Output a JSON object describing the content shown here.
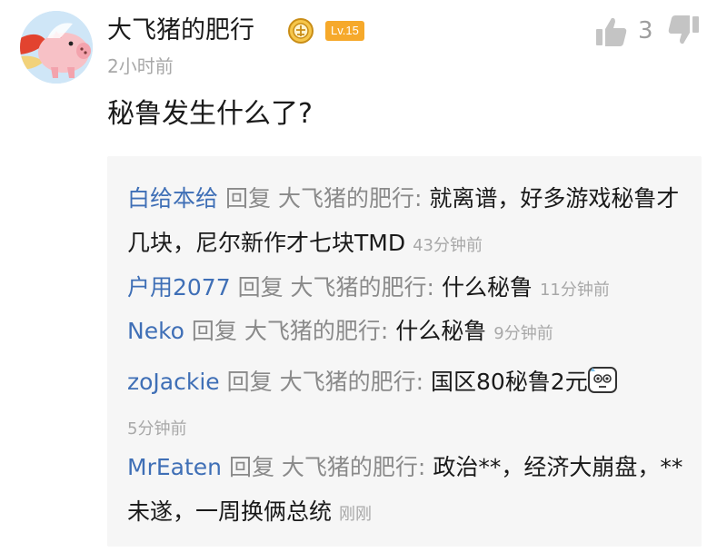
{
  "comment": {
    "username": "大飞猪的肥行",
    "level": "Lv.15",
    "timestamp": "2小时前",
    "likes": "3",
    "text": "秘鲁发生什么了?"
  },
  "replies": [
    {
      "author": "白给本给",
      "reply_word": "回复",
      "target": "大飞猪的肥行:",
      "text": "就离谱，好多游戏秘鲁才几块，尼尔新作才七块TMD",
      "time": "43分钟前"
    },
    {
      "author": "户用2077",
      "reply_word": "回复",
      "target": "大飞猪的肥行:",
      "text": "什么秘鲁",
      "time": "11分钟前"
    },
    {
      "author": "Neko",
      "reply_word": "回复",
      "target": "大飞猪的肥行:",
      "text": "什么秘鲁",
      "time": "9分钟前"
    },
    {
      "author": "zoJackie",
      "reply_word": "回复",
      "target": "大飞猪的肥行:",
      "text": "国区80秘鲁2元",
      "time": "5分钟前",
      "emoji": "sweat-face-emoji"
    },
    {
      "author": "MrEaten",
      "reply_word": "回复",
      "target": "大飞猪的肥行:",
      "text": "政治**，经济大崩盘，**未遂，一周换俩总统",
      "time": "刚刚"
    }
  ],
  "icons": {
    "avatar": "flying-pig-avatar",
    "badge": "gold-emblem-icon",
    "like": "thumbs-up-icon",
    "dislike": "thumbs-down-icon"
  },
  "colors": {
    "author_link": "#3f6fb6",
    "level_badge": "#f6a92b",
    "muted_text": "#a8a8a8",
    "reply_background": "#f6f6f6"
  }
}
